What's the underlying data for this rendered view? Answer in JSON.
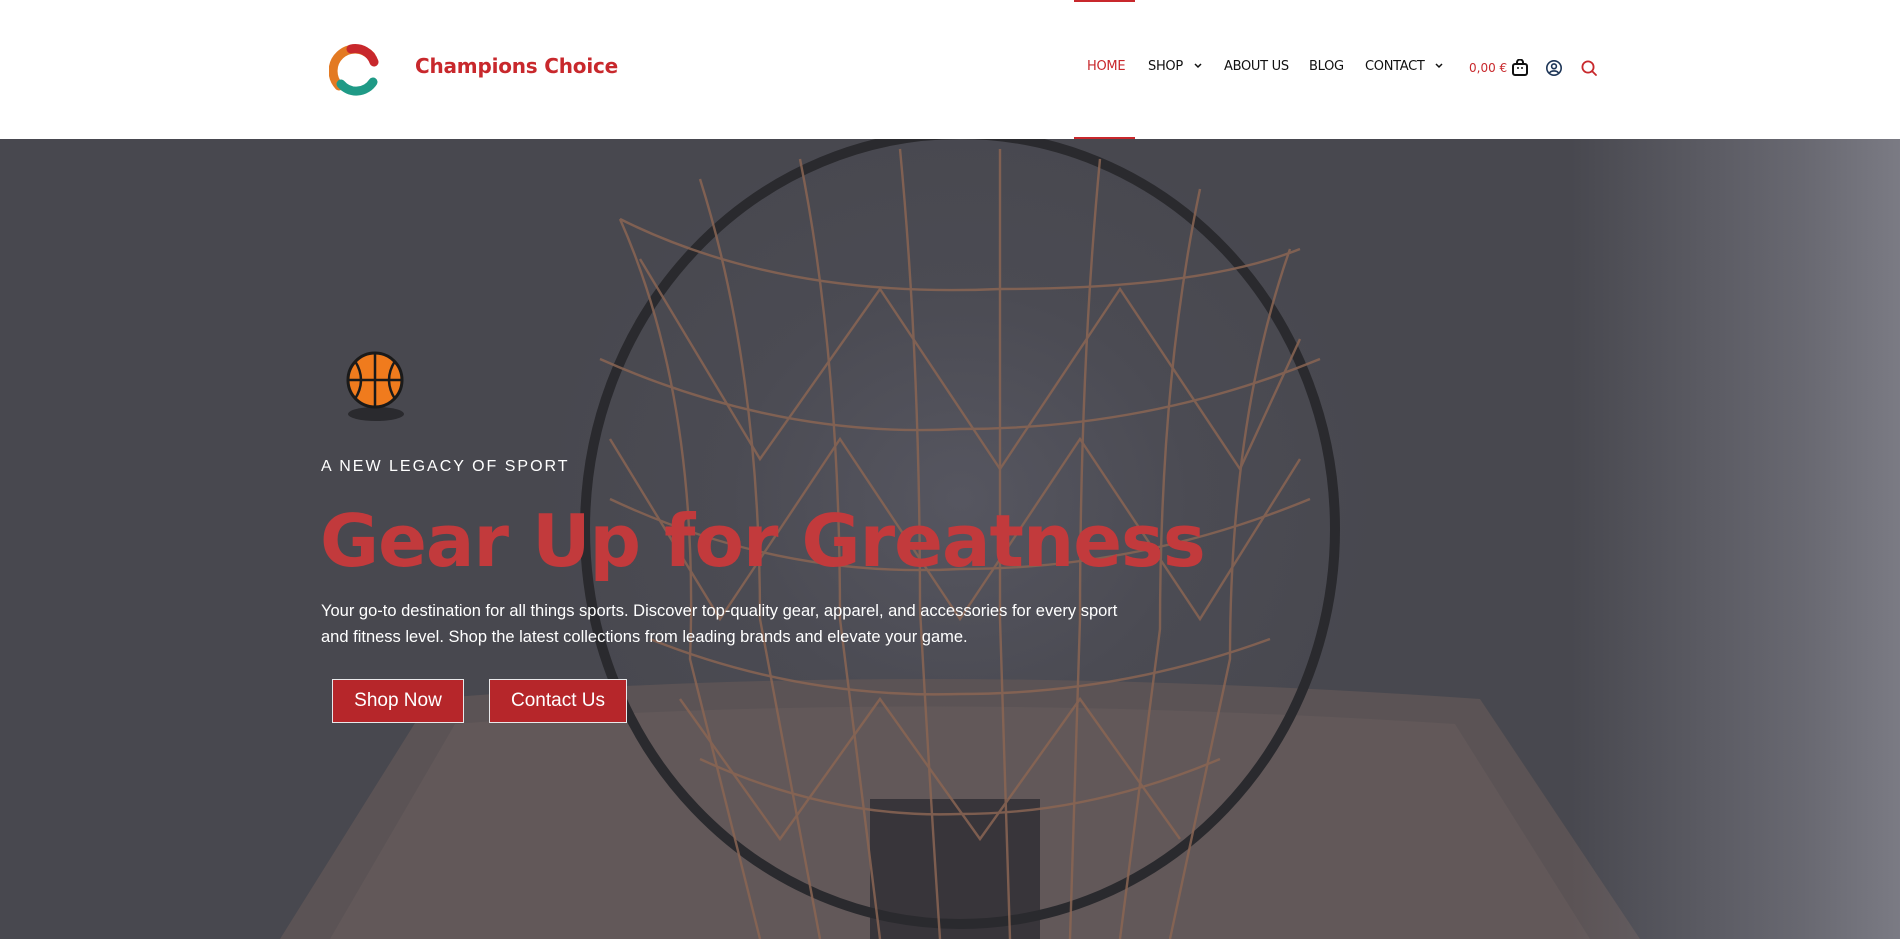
{
  "brand": {
    "name": "Champions Choice",
    "logo_icon": "c-logo-icon"
  },
  "nav": {
    "items": [
      {
        "label": "HOME",
        "active": true
      },
      {
        "label": "SHOP",
        "has_dropdown": true
      },
      {
        "label": "ABOUT US"
      },
      {
        "label": "BLOG"
      },
      {
        "label": "CONTACT",
        "has_dropdown": true
      }
    ]
  },
  "header_tools": {
    "cart_total": "0,00 €",
    "icons": [
      "cart-bag-icon",
      "account-icon",
      "search-icon"
    ]
  },
  "hero": {
    "eyebrow": "A NEW LEGACY OF SPORT",
    "headline": "Gear Up for Greatness",
    "description": "Your go-to destination for all things sports. Discover top-quality gear, apparel, and accessories for every sport and fitness level. Shop the latest collections from leading brands and elevate your game.",
    "primary_button": "Shop Now",
    "secondary_button": "Contact Us",
    "icon": "basketball-icon"
  },
  "colors": {
    "accent": "#c8282c",
    "button_bg": "#b6262a",
    "headline": "#c23a3c",
    "hero_overlay": "#4b4b53"
  }
}
